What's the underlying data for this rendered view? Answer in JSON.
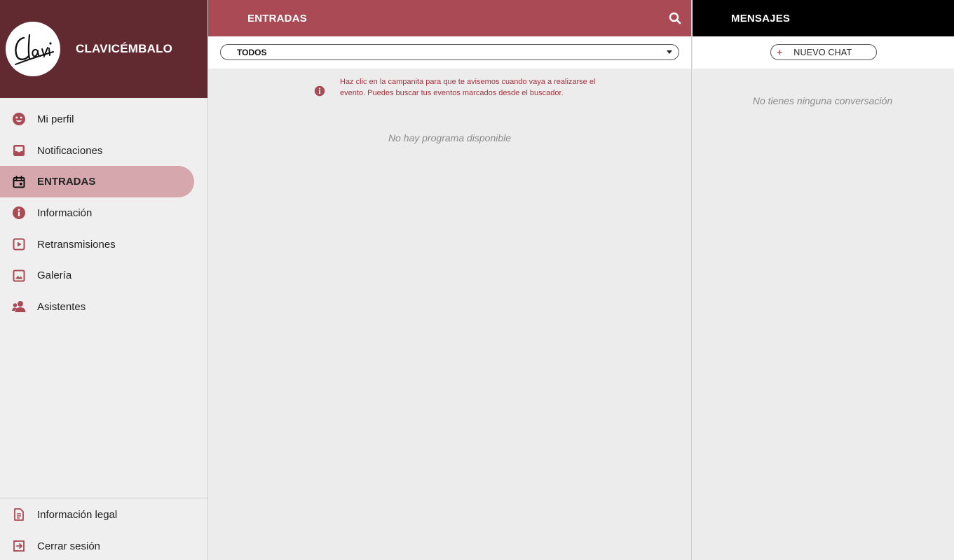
{
  "brand": {
    "logo_text": "Clavi",
    "name": "CLAVICÉMBALO"
  },
  "nav": {
    "items": [
      {
        "label": "Mi perfil",
        "icon": "face-icon"
      },
      {
        "label": "Notificaciones",
        "icon": "inbox-icon"
      },
      {
        "label": "ENTRADAS",
        "icon": "calendar-icon",
        "active": true
      },
      {
        "label": "Información",
        "icon": "info-icon"
      },
      {
        "label": "Retransmisiones",
        "icon": "play-icon"
      },
      {
        "label": "Galería",
        "icon": "image-icon"
      },
      {
        "label": "Asistentes",
        "icon": "people-icon"
      }
    ],
    "bottom": [
      {
        "label": "Información legal",
        "icon": "document-icon"
      },
      {
        "label": "Cerrar sesión",
        "icon": "logout-icon"
      }
    ]
  },
  "entradas": {
    "title": "ENTRADAS",
    "filter_selected": "TODOS",
    "hint": "Haz clic en la campanita para que te avisemos cuando vaya a realizarse el evento. Puedes buscar tus eventos marcados desde el buscador.",
    "empty": "No hay programa disponible"
  },
  "mensajes": {
    "title": "MENSAJES",
    "new_chat_plus": "+",
    "new_chat_label": "NUEVO CHAT",
    "empty": "No tienes ninguna conversación"
  },
  "colors": {
    "brand_dark": "#612a31",
    "accent": "#a94a54",
    "active_item": "#d6a8ae",
    "hint_text": "#a2343f"
  }
}
